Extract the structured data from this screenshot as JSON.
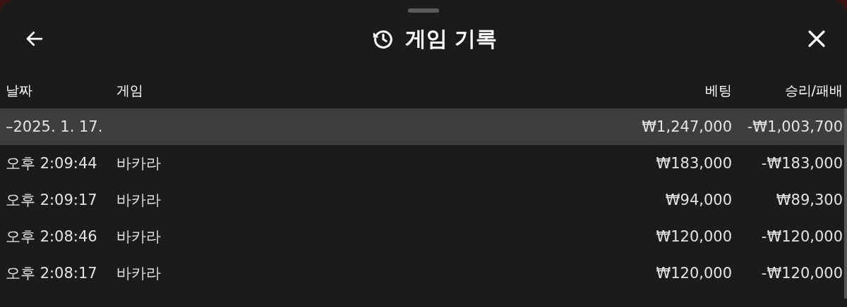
{
  "window": {
    "title": "게임 기록"
  },
  "table": {
    "columns": [
      "날짜",
      "게임",
      "베팅",
      "승리/패배"
    ],
    "groups": [
      {
        "date": "–2025. 1. 17.",
        "bet": "₩1,247,000",
        "result": "-₩1,003,700",
        "rows": [
          {
            "time": "오후 2:09:44",
            "game": "바카라",
            "bet": "₩183,000",
            "result": "-₩183,000"
          },
          {
            "time": "오후 2:09:17",
            "game": "바카라",
            "bet": "₩94,000",
            "result": "₩89,300"
          },
          {
            "time": "오후 2:08:46",
            "game": "바카라",
            "bet": "₩120,000",
            "result": "-₩120,000"
          },
          {
            "time": "오후 2:08:17",
            "game": "바카라",
            "bet": "₩120,000",
            "result": "-₩120,000"
          }
        ]
      }
    ]
  }
}
